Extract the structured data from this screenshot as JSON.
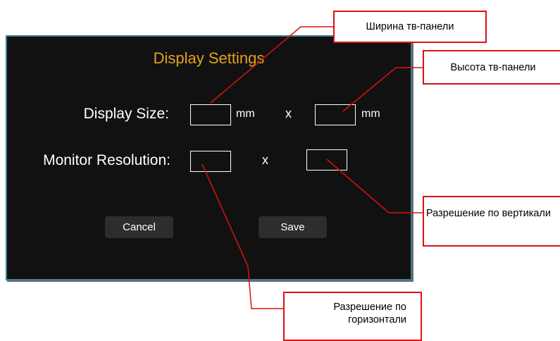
{
  "dialog": {
    "title": "Display Settings",
    "display_size_label": "Display Size:",
    "monitor_resolution_label": "Monitor Resolution:",
    "width_mm": "",
    "height_mm": "",
    "unit_mm": "mm",
    "times": "x",
    "resolution_h": "",
    "resolution_v": "",
    "cancel_label": "Cancel",
    "save_label": "Save"
  },
  "annotations": {
    "panel_width": "Ширина тв-панели",
    "panel_height": "Высота тв-панели",
    "vertical_resolution": "Разрешение по вертикали",
    "horizontal_resolution": "Разрешение по горизонтали"
  },
  "colors": {
    "dialog_bg": "#111111",
    "dialog_border": "#3d7f97",
    "title": "#e6a11c",
    "callout_border": "#dd1111"
  }
}
